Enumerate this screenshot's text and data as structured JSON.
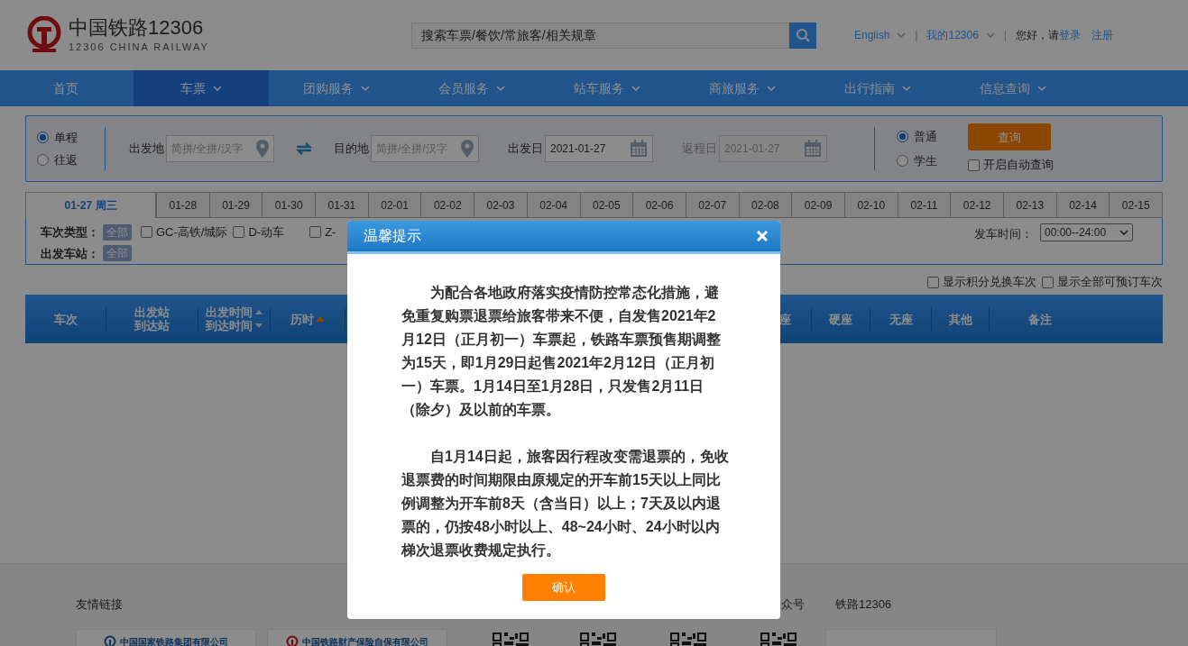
{
  "header": {
    "logo_cn": "中国铁路12306",
    "logo_en": "12306 CHINA RAILWAY",
    "search_placeholder": "搜索车票/餐饮/常旅客/相关规章",
    "language": "English",
    "account": "我的12306",
    "separator": "|",
    "greeting": "您好，请",
    "login": "登录",
    "register": "注册"
  },
  "nav": [
    {
      "label": "首页",
      "selected": false,
      "dropdown": false
    },
    {
      "label": "车票",
      "selected": true,
      "dropdown": true
    },
    {
      "label": "团购服务",
      "selected": false,
      "dropdown": true
    },
    {
      "label": "会员服务",
      "selected": false,
      "dropdown": true
    },
    {
      "label": "站车服务",
      "selected": false,
      "dropdown": true
    },
    {
      "label": "商旅服务",
      "selected": false,
      "dropdown": true
    },
    {
      "label": "出行指南",
      "selected": false,
      "dropdown": true
    },
    {
      "label": "信息查询",
      "selected": false,
      "dropdown": true
    }
  ],
  "search_form": {
    "trip_types": [
      {
        "label": "单程",
        "selected": true
      },
      {
        "label": "往返",
        "selected": false
      }
    ],
    "from": {
      "label": "出发地",
      "placeholder": "简拼/全拼/汉字"
    },
    "to": {
      "label": "目的地",
      "placeholder": "简拼/全拼/汉字"
    },
    "depart": {
      "label": "出发日",
      "value": "2021-01-27"
    },
    "return": {
      "label": "返程日",
      "value": "2021-01-27",
      "disabled": true
    },
    "passenger_types": [
      {
        "label": "普通",
        "selected": true
      },
      {
        "label": "学生",
        "selected": false
      }
    ],
    "query_button": "查询",
    "auto_query": {
      "label": "开启自动查询",
      "checked": false
    }
  },
  "date_tabs": [
    {
      "label": "01-27 周三",
      "selected": true
    },
    {
      "label": "01-28",
      "selected": false
    },
    {
      "label": "01-29",
      "selected": false
    },
    {
      "label": "01-30",
      "selected": false
    },
    {
      "label": "01-31",
      "selected": false
    },
    {
      "label": "02-01",
      "selected": false
    },
    {
      "label": "02-02",
      "selected": false
    },
    {
      "label": "02-03",
      "selected": false
    },
    {
      "label": "02-04",
      "selected": false
    },
    {
      "label": "02-05",
      "selected": false
    },
    {
      "label": "02-06",
      "selected": false
    },
    {
      "label": "02-07",
      "selected": false
    },
    {
      "label": "02-08",
      "selected": false
    },
    {
      "label": "02-09",
      "selected": false
    },
    {
      "label": "02-10",
      "selected": false
    },
    {
      "label": "02-11",
      "selected": false
    },
    {
      "label": "02-12",
      "selected": false
    },
    {
      "label": "02-13",
      "selected": false
    },
    {
      "label": "02-14",
      "selected": false
    },
    {
      "label": "02-15",
      "selected": false
    }
  ],
  "filters": {
    "train_type_label": "车次类型：",
    "train_type_all": "全部",
    "train_types": [
      {
        "label": "GC-高铁/城际",
        "checked": false
      },
      {
        "label": "D-动车",
        "checked": false
      },
      {
        "label": "Z-",
        "checked": false
      }
    ],
    "station_label": "出发车站：",
    "station_all": "全部",
    "time_label": "发车时间：",
    "time_value": "00:00--24:00"
  },
  "display_options": [
    {
      "label": "显示积分兑换车次",
      "checked": false
    },
    {
      "label": "显示全部可预订车次",
      "checked": false
    }
  ],
  "table_header": {
    "left": [
      {
        "lines": [
          "车次"
        ]
      },
      {
        "lines": [
          "出发站",
          "到达站"
        ]
      },
      {
        "lines": [
          "出发时间",
          "到达时间"
        ],
        "sortable": true
      },
      {
        "lines": [
          "历时"
        ],
        "sorted": true
      }
    ],
    "right": [
      {
        "lines": [
          "座"
        ]
      },
      {
        "lines": [
          "硬座"
        ]
      },
      {
        "lines": [
          "无座"
        ]
      },
      {
        "lines": [
          "其他"
        ]
      },
      {
        "lines": [
          "备注"
        ]
      }
    ]
  },
  "footer": {
    "links_title": "友情链接",
    "partners": [
      "中国国家铁路集团有限公司",
      "中国铁路财产保险自保有限公司"
    ],
    "wechat_title": "众号",
    "app_title": "铁路12306"
  },
  "dialog": {
    "title": "温馨提示",
    "paragraphs": [
      "为配合各地政府落实疫情防控常态化措施，避免重复购票退票给旅客带来不便，自发售2021年2月12日（正月初一）车票起，铁路车票预售期调整为15天，即1月29日起售2021年2月12日（正月初一）车票。1月14日至1月28日，只发售2月11日（除夕）及以前的车票。",
      "自1月14日起，旅客因行程改变需退票的，免收退票费的时间期限由原规定的开车前15天以上同比例调整为开车前8天（含当日）以上；7天及以内退票的，仍按48小时以上、48~24小时、24小时以内梯次退票收费规定执行。"
    ],
    "confirm": "确认"
  }
}
